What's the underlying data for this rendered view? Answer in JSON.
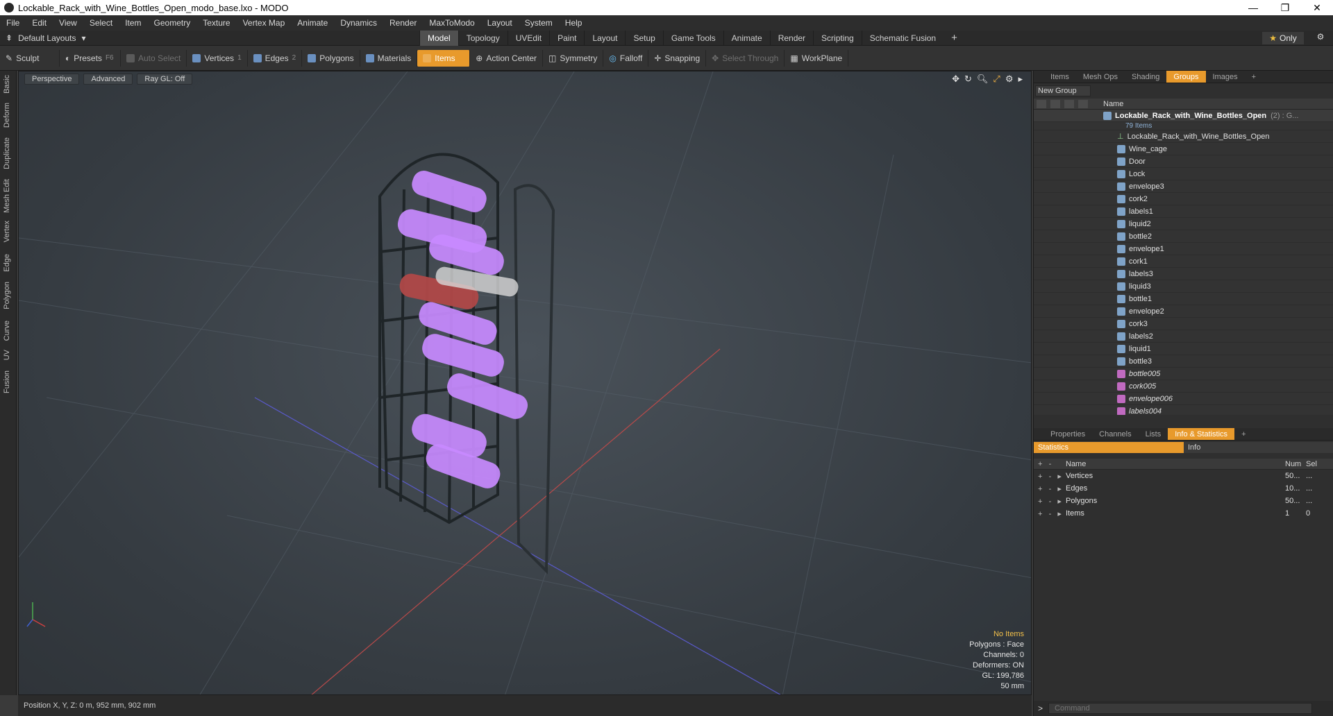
{
  "window": {
    "title": "Lockable_Rack_with_Wine_Bottles_Open_modo_base.lxo - MODO",
    "minimize": "—",
    "maximize": "❐",
    "close": "✕"
  },
  "menu": [
    "File",
    "Edit",
    "View",
    "Select",
    "Item",
    "Geometry",
    "Texture",
    "Vertex Map",
    "Animate",
    "Dynamics",
    "Render",
    "MaxToModo",
    "Layout",
    "System",
    "Help"
  ],
  "layout": {
    "name": "Default Layouts",
    "tabs": [
      "Model",
      "Topology",
      "UVEdit",
      "Paint",
      "Layout",
      "Setup",
      "Game Tools",
      "Animate",
      "Render",
      "Scripting",
      "Schematic Fusion"
    ],
    "active_tab": "Model",
    "only_label": "Only"
  },
  "toolbar": {
    "sculpt": "Sculpt",
    "presets": "Presets",
    "presets_key": "F6",
    "auto_select": "Auto Select",
    "vertices": "Vertices",
    "vertices_count": "1",
    "edges": "Edges",
    "edges_count": "2",
    "polygons": "Polygons",
    "materials": "Materials",
    "items": "Items",
    "action_center": "Action Center",
    "symmetry": "Symmetry",
    "falloff": "Falloff",
    "snapping": "Snapping",
    "select_through": "Select Through",
    "workplane": "WorkPlane"
  },
  "left_tabs": [
    "Basic",
    "Deform",
    "Duplicate",
    "Mesh Edit",
    "Vertex",
    "Edge",
    "Polygon",
    "Curve",
    "UV",
    "Fusion"
  ],
  "viewport": {
    "perspective": "Perspective",
    "advanced": "Advanced",
    "raygl": "Ray GL: Off",
    "info": {
      "no_items": "No Items",
      "polygons": "Polygons : Face",
      "channels": "Channels: 0",
      "deformers": "Deformers: ON",
      "gl": "GL: 199,786",
      "scale": "50 mm"
    },
    "wire_color": "#c88aff"
  },
  "status": {
    "position": "Position X, Y, Z:  0 m, 952 mm, 902 mm"
  },
  "items_panel": {
    "tabs": [
      "Items",
      "Mesh Ops",
      "Shading",
      "Groups",
      "Images"
    ],
    "active_tab": "Groups",
    "new_group": "New Group",
    "name_header": "Name",
    "root": {
      "name": "Lockable_Rack_with_Wine_Bottles_Open",
      "suffix": "(2) : G...",
      "count": "79 Items"
    },
    "items": [
      "Lockable_Rack_with_Wine_Bottles_Open",
      "Wine_cage",
      "Door",
      "Lock",
      "envelope3",
      "cork2",
      "labels1",
      "liquid2",
      "bottle2",
      "envelope1",
      "cork1",
      "labels3",
      "liquid3",
      "bottle1",
      "envelope2",
      "cork3",
      "labels2",
      "liquid1",
      "bottle3"
    ],
    "italic_items": [
      "bottle005",
      "cork005",
      "envelope006",
      "labels004"
    ]
  },
  "stats_panel": {
    "tabs": [
      "Properties",
      "Channels",
      "Lists",
      "Info & Statistics"
    ],
    "active_tab": "Info & Statistics",
    "sub_statistics": "Statistics",
    "sub_info": "Info",
    "headers": {
      "name": "Name",
      "num": "Num",
      "sel": "Sel"
    },
    "rows": [
      {
        "name": "Vertices",
        "num": "50...",
        "sel": "..."
      },
      {
        "name": "Edges",
        "num": "10...",
        "sel": "..."
      },
      {
        "name": "Polygons",
        "num": "50...",
        "sel": "..."
      },
      {
        "name": "Items",
        "num": "1",
        "sel": "0"
      }
    ]
  },
  "command": {
    "placeholder": "Command"
  }
}
